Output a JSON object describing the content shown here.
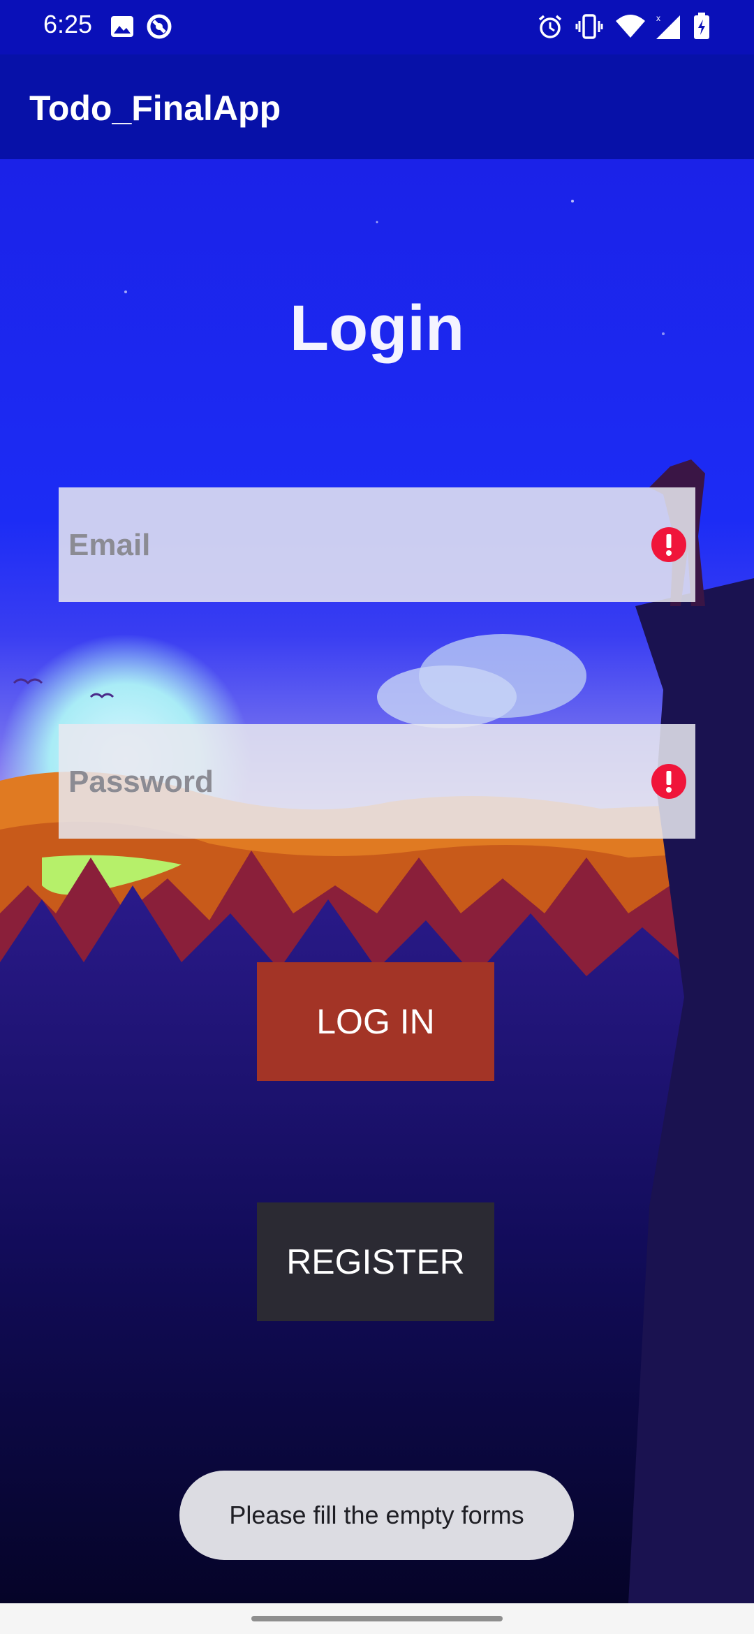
{
  "status_bar": {
    "time": "6:25",
    "icons": [
      "image-icon",
      "sync-icon",
      "alarm-icon",
      "vibrate-icon",
      "wifi-icon",
      "signal-icon",
      "battery-charging-icon"
    ]
  },
  "app_bar": {
    "title": "Todo_FinalApp"
  },
  "login": {
    "title": "Login",
    "email_placeholder": "Email",
    "password_placeholder": "Password",
    "login_button": "LOG IN",
    "register_button": "REGISTER"
  },
  "toast": {
    "message": "Please fill the empty forms"
  },
  "colors": {
    "status_bar": "#0a10b8",
    "app_bar": "#0711a8",
    "login_button": "#a33426",
    "register_button": "#2b2a33",
    "error": "#f0153a"
  }
}
